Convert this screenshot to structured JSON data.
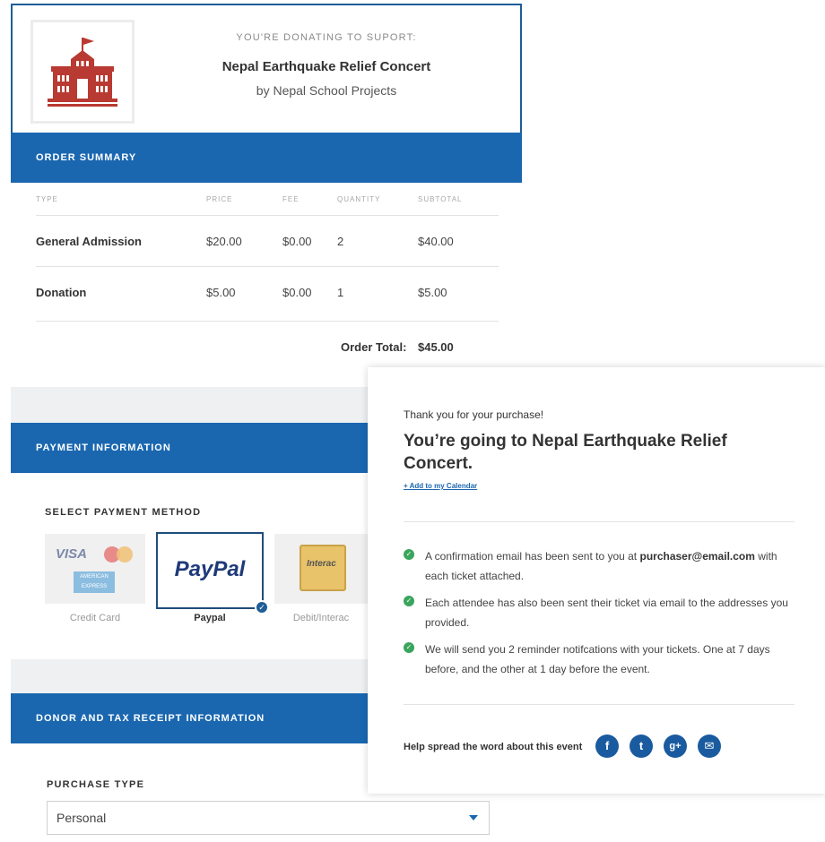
{
  "support": {
    "kicker": "YOU'RE DONATING TO SUPORT:",
    "event_name": "Nepal Earthquake Relief Concert",
    "org": "by Nepal School Projects"
  },
  "order_summary": {
    "title": "ORDER SUMMARY",
    "columns": [
      "TYPE",
      "PRICE",
      "FEE",
      "QUANTITY",
      "SUBTOTAL"
    ],
    "rows": [
      {
        "type": "General Admission",
        "price": "$20.00",
        "fee": "$0.00",
        "qty": "2",
        "subtotal": "$40.00"
      },
      {
        "type": "Donation",
        "price": "$5.00",
        "fee": "$0.00",
        "qty": "1",
        "subtotal": "$5.00"
      }
    ],
    "total_label": "Order Total:",
    "total_value": "$45.00"
  },
  "payment": {
    "title": "PAYMENT INFORMATION",
    "select_label": "SELECT PAYMENT METHOD",
    "methods": [
      {
        "label": "Credit Card",
        "icon": "credit-card-logos",
        "selected": false
      },
      {
        "label": "Paypal",
        "icon": "paypal-logo",
        "selected": true
      },
      {
        "label": "Debit/Interac",
        "icon": "interac-logo",
        "selected": false
      }
    ],
    "card_logos": {
      "visa": "VISA",
      "amex": "AMERICAN EXPRESS"
    },
    "paypal_logo": "PayPal",
    "interac_logo": "Interac"
  },
  "donor": {
    "title": "DONOR AND TAX RECEIPT INFORMATION",
    "purchase_type_label": "PURCHASE TYPE",
    "purchase_type_value": "Personal"
  },
  "confirmation": {
    "thanks": "Thank you for your purchase!",
    "headline": "You’re going to Nepal Earthquake Relief Concert.",
    "calendar_link": "+ Add to my Calendar",
    "bullets": [
      {
        "text": "A confirmation email has been sent to you at ",
        "email": "purchaser@email.com",
        "after": " with each ticket attached."
      },
      {
        "text": "Each attendee has also been sent their ticket via email to the addresses you provided."
      },
      {
        "text": "We will send you 2 reminder notifcations with your tickets. One at 7 days before, and the other at 1 day before the event."
      }
    ],
    "spread": "Help spread the word about this event",
    "social": [
      {
        "name": "facebook",
        "glyph": "f"
      },
      {
        "name": "twitter",
        "glyph": "t"
      },
      {
        "name": "google-plus",
        "glyph": "g+"
      },
      {
        "name": "email",
        "glyph": "✉"
      }
    ]
  },
  "colors": {
    "brand_blue": "#1a67b0",
    "success_green": "#3aa55d",
    "school_red": "#b83a32"
  }
}
